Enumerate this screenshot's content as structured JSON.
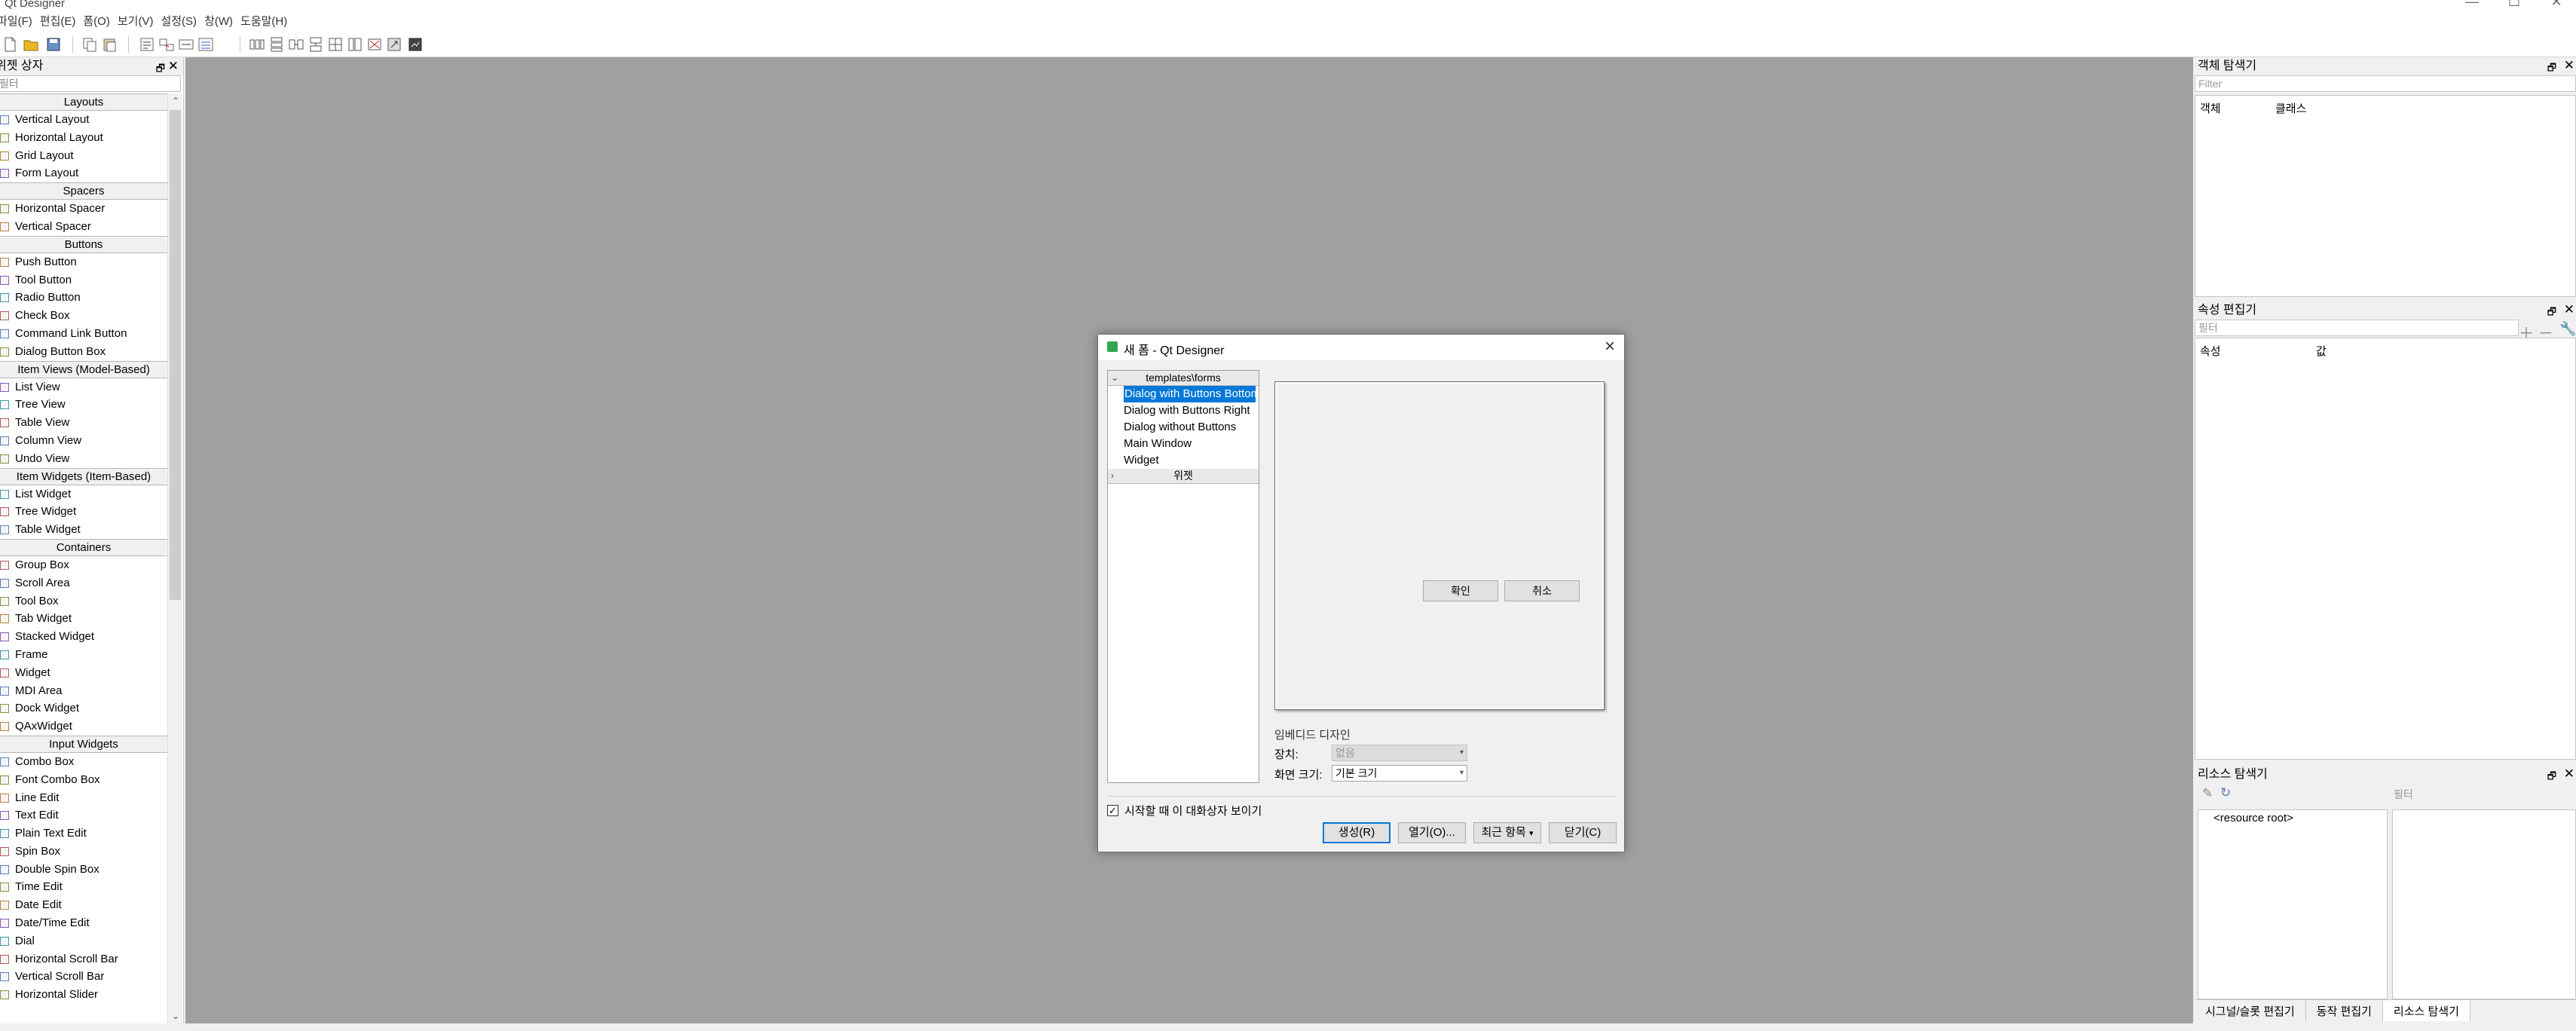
{
  "window": {
    "title": "Qt Designer",
    "controls": [
      "—",
      "☐",
      "✕"
    ]
  },
  "menubar": [
    "파일(F)",
    "편집(E)",
    "폼(O)",
    "보기(V)",
    "설정(S)",
    "창(W)",
    "도움말(H)"
  ],
  "widget_box": {
    "title": "위젯 상자",
    "filter_placeholder": "필터",
    "sections": [
      {
        "name": "Layouts",
        "items": [
          "Vertical Layout",
          "Horizontal Layout",
          "Grid Layout",
          "Form Layout"
        ]
      },
      {
        "name": "Spacers",
        "items": [
          "Horizontal Spacer",
          "Vertical Spacer"
        ]
      },
      {
        "name": "Buttons",
        "items": [
          "Push Button",
          "Tool Button",
          "Radio Button",
          "Check Box",
          "Command Link Button",
          "Dialog Button Box"
        ]
      },
      {
        "name": "Item Views (Model-Based)",
        "items": [
          "List View",
          "Tree View",
          "Table View",
          "Column View",
          "Undo View"
        ]
      },
      {
        "name": "Item Widgets (Item-Based)",
        "items": [
          "List Widget",
          "Tree Widget",
          "Table Widget"
        ]
      },
      {
        "name": "Containers",
        "items": [
          "Group Box",
          "Scroll Area",
          "Tool Box",
          "Tab Widget",
          "Stacked Widget",
          "Frame",
          "Widget",
          "MDI Area",
          "Dock Widget",
          "QAxWidget"
        ]
      },
      {
        "name": "Input Widgets",
        "items": [
          "Combo Box",
          "Font Combo Box",
          "Line Edit",
          "Text Edit",
          "Plain Text Edit",
          "Spin Box",
          "Double Spin Box",
          "Time Edit",
          "Date Edit",
          "Date/Time Edit",
          "Dial",
          "Horizontal Scroll Bar",
          "Vertical Scroll Bar",
          "Horizontal Slider"
        ]
      }
    ]
  },
  "object_inspector": {
    "title": "객체 탐색기",
    "filter_placeholder": "Filter",
    "columns": [
      "객체",
      "클래스"
    ]
  },
  "property_editor": {
    "title": "속성 편집기",
    "filter_placeholder": "필터",
    "columns": [
      "속성",
      "값"
    ]
  },
  "resource_browser": {
    "title": "리소스 탐색기",
    "filter_placeholder": "필터",
    "root": "<resource root>"
  },
  "bottom_tabs": [
    "시그널/슬롯 편집기",
    "동작 편집기",
    "리소스 탐색기"
  ],
  "dialog": {
    "title": "새 폼 - Qt Designer",
    "tree": {
      "group1": "templates\\forms",
      "items": [
        "Dialog with Buttons Bottom",
        "Dialog with Buttons Right",
        "Dialog without Buttons",
        "Main Window",
        "Widget"
      ],
      "selected_index": 0,
      "group2": "위젯"
    },
    "preview_buttons": [
      "확인",
      "취소"
    ],
    "embedded": {
      "legend": "임베디드 디자인",
      "device_label": "장치:",
      "device_value": "없음",
      "size_label": "화면 크기:",
      "size_value": "기본 크기"
    },
    "show_on_startup": {
      "label": "시작할 때 이 대화상자 보이기",
      "checked": true
    },
    "buttons": {
      "create": "생성(R)",
      "open": "열기(O)...",
      "recent": "최근 항목",
      "close": "닫기(C)"
    }
  },
  "colors": {
    "mdi_bg": "#a0a0a0",
    "selection": "#0078d7",
    "dialog_bg": "#f0f0f0"
  }
}
